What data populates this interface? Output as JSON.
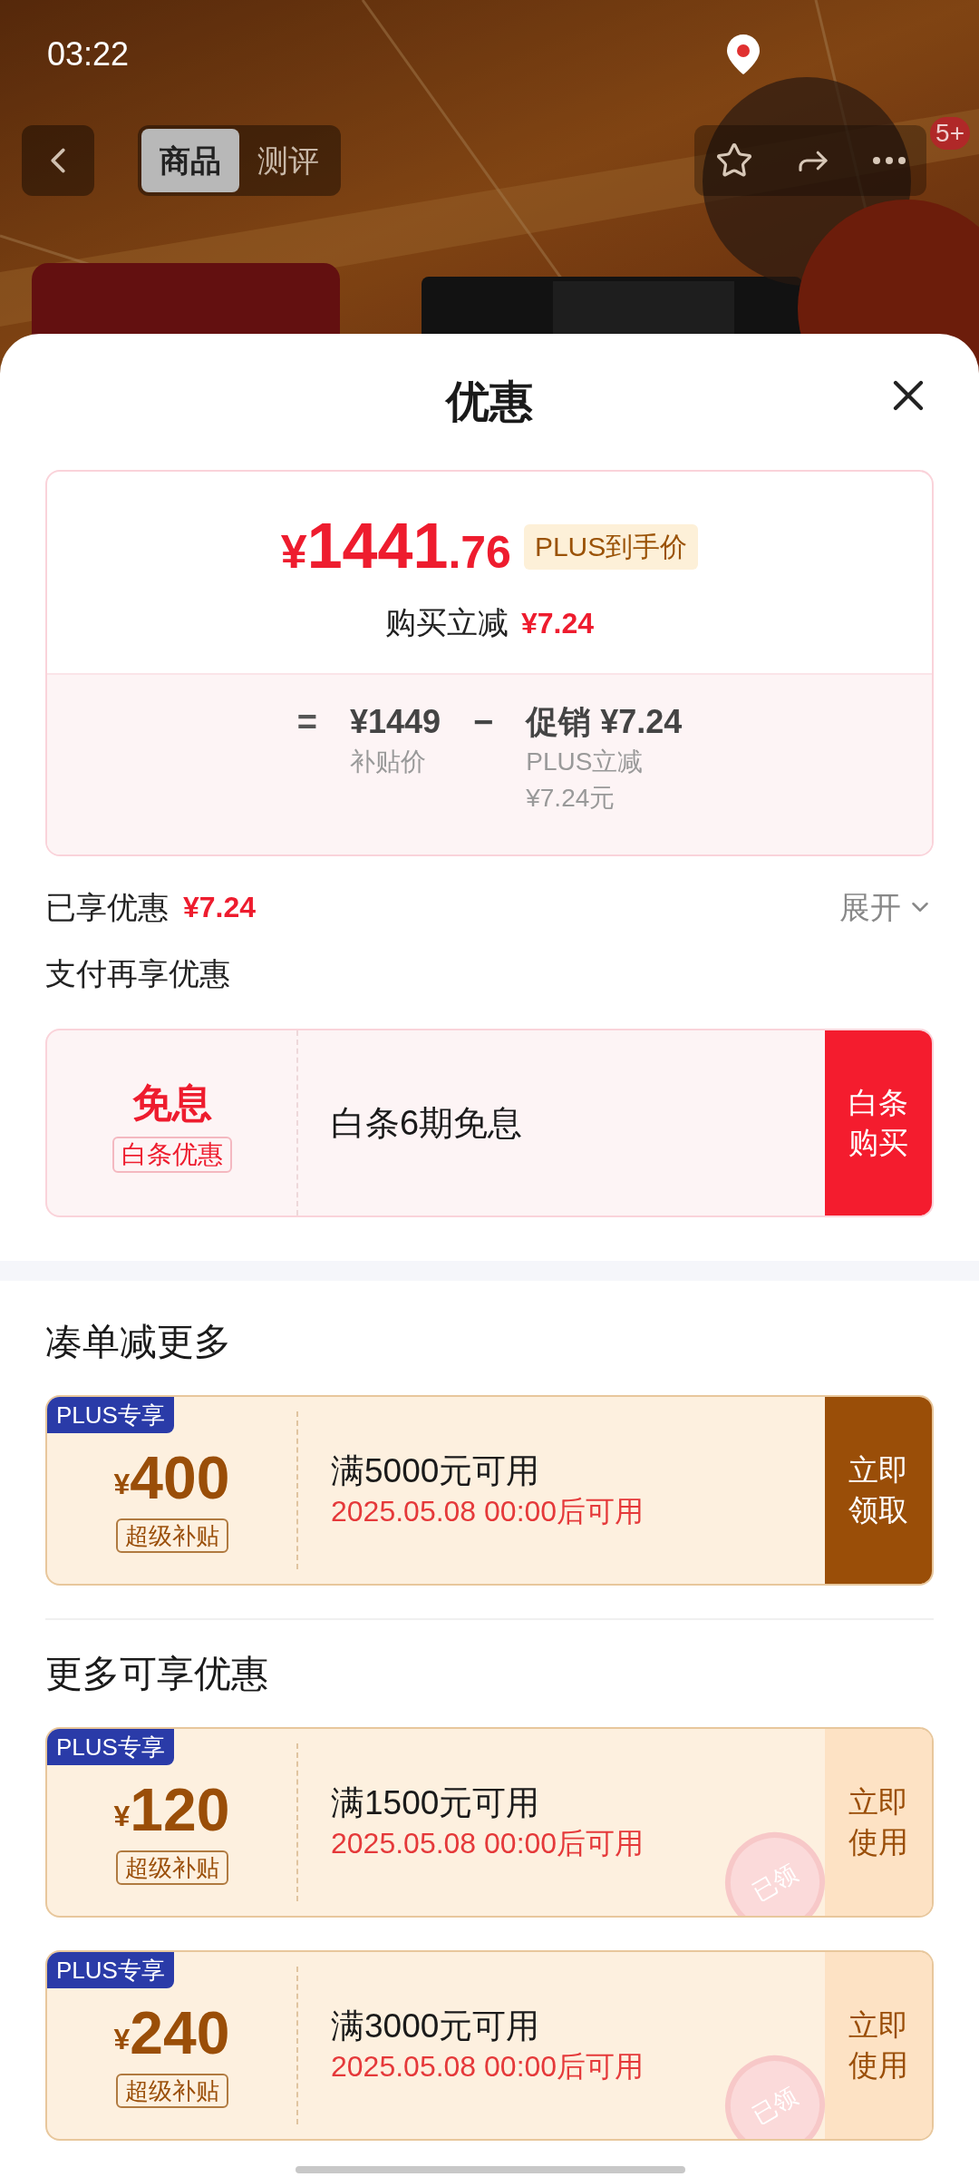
{
  "status_bar": {
    "time": "03:22"
  },
  "nav": {
    "tabs": [
      {
        "label": "商品",
        "selected": true
      },
      {
        "label": "测评",
        "selected": false
      }
    ],
    "badge": "5+"
  },
  "sheet": {
    "title": "优惠"
  },
  "price_card": {
    "currency": "¥",
    "price_integer": "1441",
    "price_decimal": ".76",
    "price_tag": "PLUS到手价",
    "reduction_label": "购买立减",
    "reduction_value": "¥7.24",
    "formula": {
      "equals": "=",
      "base_price": "¥1449",
      "base_label": "补贴价",
      "minus": "−",
      "promo": "促销 ¥7.24",
      "promo_detail": "PLUS立减",
      "promo_amount": "¥7.24元"
    }
  },
  "enjoyed": {
    "label": "已享优惠",
    "amount": "¥7.24",
    "expand": "展开"
  },
  "pay_section": {
    "title": "支付再享优惠",
    "offer": {
      "headline": "免息",
      "tag": "白条优惠",
      "description": "白条6期免息",
      "button": "白条购买"
    }
  },
  "sections": [
    {
      "title": "凑单减更多",
      "coupons": [
        {
          "kind": "claim",
          "tag": "PLUS专享",
          "currency": "¥",
          "amount": "400",
          "label": "超级补贴",
          "condition": "满5000元可用",
          "validity": "2025.05.08 00:00后可用",
          "button": "立即领取"
        }
      ]
    },
    {
      "title": "更多可享优惠",
      "coupons": [
        {
          "kind": "use",
          "tag": "PLUS专享",
          "currency": "¥",
          "amount": "120",
          "label": "超级补贴",
          "condition": "满1500元可用",
          "validity": "2025.05.08 00:00后可用",
          "button": "立即使用",
          "stamp": "已领"
        },
        {
          "kind": "use",
          "tag": "PLUS专享",
          "currency": "¥",
          "amount": "240",
          "label": "超级补贴",
          "condition": "满3000元可用",
          "validity": "2025.05.08 00:00后可用",
          "button": "立即使用",
          "stamp": "已领"
        }
      ]
    }
  ]
}
